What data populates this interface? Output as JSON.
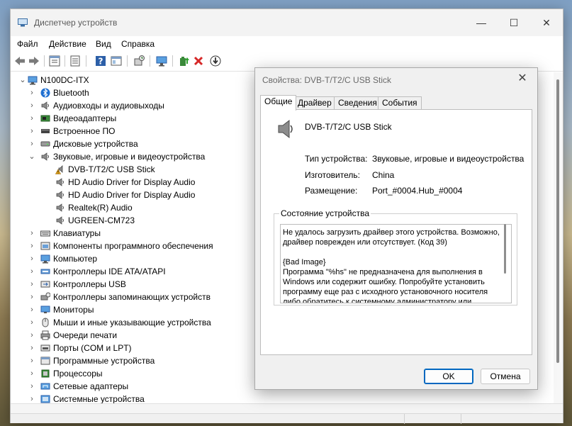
{
  "window": {
    "title": "Диспетчер устройств",
    "minimize": "—",
    "maximize": "☐",
    "close": "✕"
  },
  "menu": [
    "Файл",
    "Действие",
    "Вид",
    "Справка"
  ],
  "tree": {
    "root": "N100DC-ITX",
    "categories": [
      {
        "label": "Bluetooth",
        "icon": "bluetooth-icon",
        "expanded": false
      },
      {
        "label": "Аудиовходы и аудиовыходы",
        "icon": "speaker-icon",
        "expanded": false
      },
      {
        "label": "Видеоадаптеры",
        "icon": "display-adapter-icon",
        "expanded": false
      },
      {
        "label": "Встроенное ПО",
        "icon": "firmware-icon",
        "expanded": false
      },
      {
        "label": "Дисковые устройства",
        "icon": "disk-icon",
        "expanded": false
      },
      {
        "label": "Звуковые, игровые и видеоустройства",
        "icon": "speaker-icon",
        "expanded": true,
        "children": [
          {
            "label": "DVB-T/T2/C USB Stick",
            "icon": "warning-speaker-icon"
          },
          {
            "label": "HD Audio Driver for Display Audio",
            "icon": "speaker-icon"
          },
          {
            "label": "HD Audio Driver for Display Audio",
            "icon": "speaker-icon"
          },
          {
            "label": "Realtek(R) Audio",
            "icon": "speaker-icon"
          },
          {
            "label": "UGREEN-CM723",
            "icon": "speaker-icon"
          }
        ]
      },
      {
        "label": "Клавиатуры",
        "icon": "keyboard-icon",
        "expanded": false
      },
      {
        "label": "Компоненты программного обеспечения",
        "icon": "software-component-icon",
        "expanded": false
      },
      {
        "label": "Компьютер",
        "icon": "computer-icon",
        "expanded": false
      },
      {
        "label": "Контроллеры IDE ATA/ATAPI",
        "icon": "ide-controller-icon",
        "expanded": false
      },
      {
        "label": "Контроллеры USB",
        "icon": "usb-icon",
        "expanded": false
      },
      {
        "label": "Контроллеры запоминающих устройств",
        "icon": "storage-controller-icon",
        "expanded": false
      },
      {
        "label": "Мониторы",
        "icon": "monitor-icon",
        "expanded": false
      },
      {
        "label": "Мыши и иные указывающие устройства",
        "icon": "mouse-icon",
        "expanded": false
      },
      {
        "label": "Очереди печати",
        "icon": "printer-icon",
        "expanded": false
      },
      {
        "label": "Порты (COM и LPT)",
        "icon": "port-icon",
        "expanded": false
      },
      {
        "label": "Программные устройства",
        "icon": "software-device-icon",
        "expanded": false
      },
      {
        "label": "Процессоры",
        "icon": "processor-icon",
        "expanded": false
      },
      {
        "label": "Сетевые адаптеры",
        "icon": "network-adapter-icon",
        "expanded": false
      },
      {
        "label": "Системные устройства",
        "icon": "system-device-icon",
        "expanded": false
      }
    ]
  },
  "dialog": {
    "title": "Свойства: DVB-T/T2/C USB Stick",
    "close": "✕",
    "tabs": [
      "Общие",
      "Драйвер",
      "Сведения",
      "События"
    ],
    "active_tab": 0,
    "device_name": "DVB-T/T2/C USB Stick",
    "properties": [
      {
        "label": "Тип устройства:",
        "value": "Звуковые, игровые и видеоустройства"
      },
      {
        "label": "Изготовитель:",
        "value": "China"
      },
      {
        "label": "Размещение:",
        "value": "Port_#0004.Hub_#0004"
      }
    ],
    "status_legend": "Состояние устройства",
    "status_text": "Не удалось загрузить драйвер этого устройства. Возможно, драйвер поврежден или отсутствует. (Код 39)\n\n{Bad Image}\nПрограмма \"%hs\" не предназначена для выполнения в Windows или содержит ошибку. Попробуйте установить программу еще раз с исходного установочного носителя либо обратитесь к системному администратору или",
    "ok": "OK",
    "cancel": "Отмена"
  },
  "colors": {
    "accent": "#0067c0",
    "warning": "#f2b01e",
    "delete": "#d62828",
    "arrow": "#7a7a7a"
  }
}
